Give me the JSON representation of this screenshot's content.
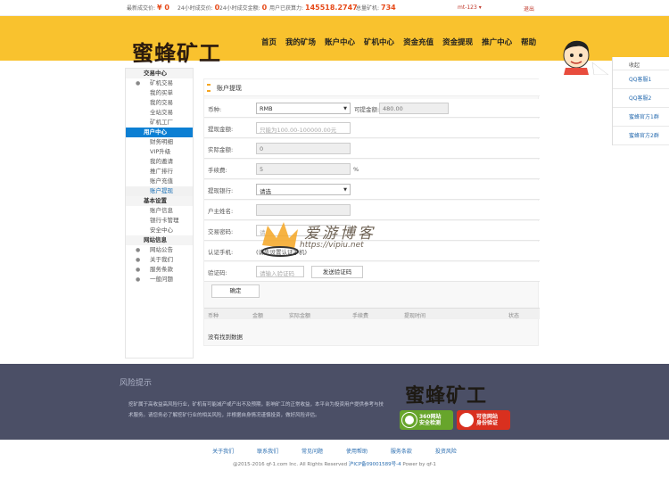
{
  "topbar": {
    "stats": [
      {
        "label": "最新成交价:",
        "value": "¥ 0"
      },
      {
        "label": "24小时成交价:",
        "value": "0"
      },
      {
        "label": "24小时成交金额:",
        "value": "0"
      },
      {
        "label": "用户已获算力:",
        "value": "145518.2747"
      },
      {
        "label": "总量矿机:",
        "value": "734"
      }
    ],
    "user": "mt-123 ▾",
    "logout": "退出"
  },
  "header": {
    "logo": "蜜蜂矿工",
    "nav": [
      "首页",
      "我的矿场",
      "账户中心",
      "矿机中心",
      "资金充值",
      "资金提现",
      "推广中心",
      "帮助"
    ]
  },
  "float_panel": {
    "collapse_icon": "chevron-right",
    "title": "收起",
    "items": [
      "QQ客服1",
      "QQ客服2",
      "蜜蜂官方1群",
      "蜜蜂官方2群"
    ]
  },
  "sidebar": {
    "sections": [
      {
        "title": "交易中心",
        "items": [
          {
            "label": "矿机交易",
            "icon": "dot"
          },
          {
            "label": "我的买单"
          },
          {
            "label": "我的交易"
          },
          {
            "label": "全站交易"
          },
          {
            "label": "矿机工厂"
          }
        ]
      },
      {
        "title": "用户中心",
        "active_title": true,
        "items": [
          {
            "label": "财务明细"
          },
          {
            "label": "VIP升级"
          },
          {
            "label": "我的邀请"
          },
          {
            "label": "推广排行"
          },
          {
            "label": "账户充值"
          },
          {
            "label": "账户提现",
            "active": true
          }
        ]
      },
      {
        "title": "基本设置",
        "items": [
          {
            "label": "账户信息"
          },
          {
            "label": "银行卡管理"
          },
          {
            "label": "安全中心"
          }
        ]
      },
      {
        "title": "网站信息",
        "items": [
          {
            "label": "网站公告",
            "icon": "dot"
          },
          {
            "label": "关于我们",
            "icon": "dot"
          },
          {
            "label": "服务条款",
            "icon": "dot"
          },
          {
            "label": "一般问题",
            "icon": "dot"
          }
        ]
      }
    ]
  },
  "main": {
    "title": "账户提现",
    "form": {
      "currency_label": "币种:",
      "currency_value": "RMB",
      "balance_label": "可提金额:",
      "balance_value": "480.00",
      "amount_label": "提现金额:",
      "amount_placeholder": "只能为100.00-100000.00元",
      "actual_label": "实际金额:",
      "actual_value": "0",
      "fee_label": "手续费:",
      "fee_value": "5",
      "fee_unit": "%",
      "bank_label": "提现银行:",
      "bank_value": "请选",
      "account_label": "户主姓名:",
      "account_value": "",
      "trade_pwd_label": "交易密码:",
      "trade_pwd_value": "请",
      "phone_label": "认证手机:",
      "phone_value": "(请先设置认证手机)",
      "captcha_label": "验证码:",
      "captcha_placeholder": "请输入验证码",
      "send_code_label": "发送验证码",
      "submit_label": "确定"
    },
    "table": {
      "headers": [
        "币种",
        "金额",
        "实际金额",
        "手续费",
        "提现时间",
        "状态"
      ],
      "empty_text": "没有找到数据"
    }
  },
  "watermark": {
    "text": "爱游博客",
    "url": "https://vipiu.net"
  },
  "footer": {
    "risk_title": "风险提示",
    "risk_text": "挖矿属于高收益高风险行业，矿机有可能减产或产出不及预期，影响矿工的正常收益，本平台为投资用户提供参考与技术服务。请您务必了解挖矿行业的相关风险，并根据自身情况谨慎投资，做好风险评估。",
    "logo": "蜜蜂矿工",
    "badges": [
      {
        "line1": "360网站",
        "line2": "安全检测",
        "color": "#67a52b"
      },
      {
        "line1": "可信网站",
        "line2": "身份验证",
        "color": "#d9301f"
      }
    ]
  },
  "bottom_links": [
    "关于我们",
    "联系我们",
    "常见问题",
    "使用帮助",
    "服务条款",
    "投资风险"
  ],
  "copyright": {
    "text": "@2015-2016 qf-1.com Inc. All Rights Reserved",
    "icp": "沪ICP备09001589号-4",
    "powered": "Power by qf-1"
  }
}
